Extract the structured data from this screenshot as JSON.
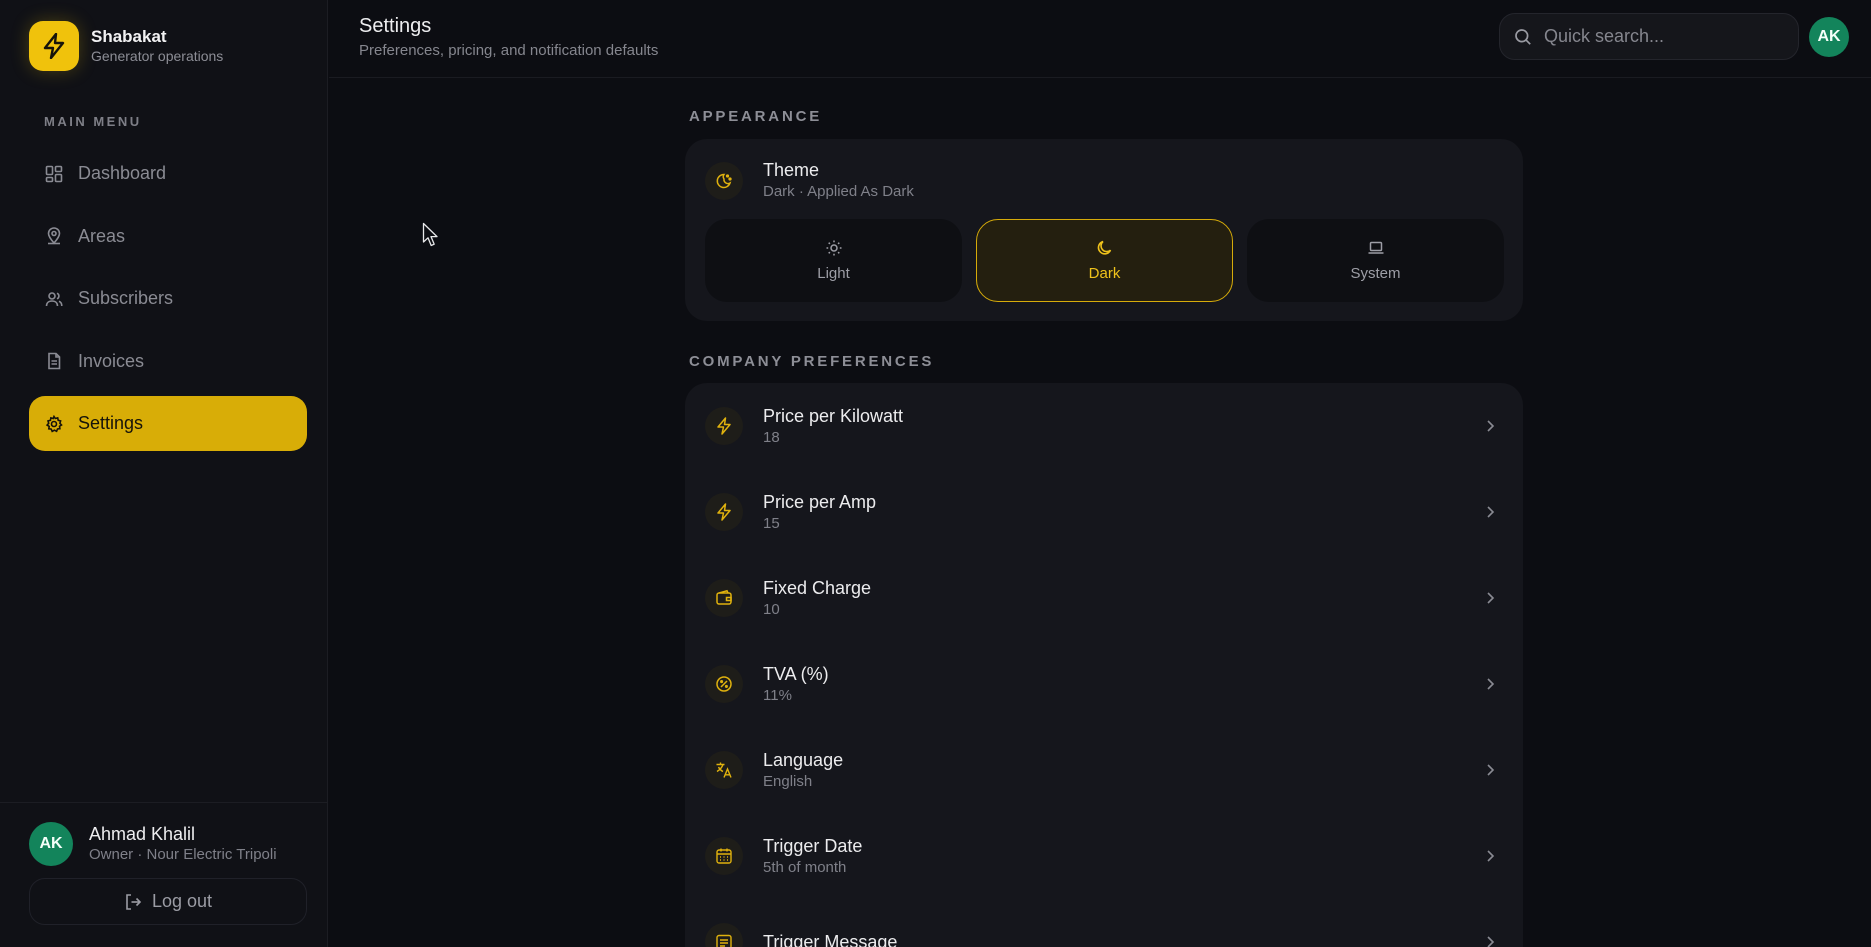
{
  "brand": {
    "name": "Shabakat",
    "subtitle": "Generator operations",
    "logo_icon": "bolt-icon",
    "accent": "#f0c20c"
  },
  "sidebar": {
    "menu_title": "MAIN MENU",
    "items": [
      {
        "label": "Dashboard",
        "icon": "grid-icon",
        "active": false
      },
      {
        "label": "Areas",
        "icon": "map-pin-icon",
        "active": false
      },
      {
        "label": "Subscribers",
        "icon": "users-icon",
        "active": false
      },
      {
        "label": "Invoices",
        "icon": "document-icon",
        "active": false
      },
      {
        "label": "Settings",
        "icon": "gear-icon",
        "active": true
      }
    ],
    "user": {
      "initials": "AK",
      "name": "Ahmad Khalil",
      "role": "Owner · Nour Electric Tripoli"
    },
    "logout_label": "Log out"
  },
  "header": {
    "title": "Settings",
    "subtitle": "Preferences, pricing, and notification defaults",
    "search_placeholder": "Quick search...",
    "avatar_initials": "AK"
  },
  "appearance": {
    "section_title": "APPEARANCE",
    "theme": {
      "title": "Theme",
      "subtitle": "Dark · Applied As Dark",
      "options": [
        {
          "label": "Light",
          "icon": "sun-icon",
          "selected": false
        },
        {
          "label": "Dark",
          "icon": "moon-icon",
          "selected": true
        },
        {
          "label": "System",
          "icon": "laptop-icon",
          "selected": false
        }
      ]
    }
  },
  "company_preferences": {
    "section_title": "COMPANY PREFERENCES",
    "rows": [
      {
        "title": "Price per Kilowatt",
        "value": "18",
        "icon": "bolt-icon"
      },
      {
        "title": "Price per Amp",
        "value": "15",
        "icon": "bolt-icon"
      },
      {
        "title": "Fixed Charge",
        "value": "10",
        "icon": "wallet-icon"
      },
      {
        "title": "TVA (%)",
        "value": "11%",
        "icon": "percent-icon"
      },
      {
        "title": "Language",
        "value": "English",
        "icon": "translate-icon"
      },
      {
        "title": "Trigger Date",
        "value": "5th of month",
        "icon": "calendar-icon"
      },
      {
        "title": "Trigger Message",
        "value": "",
        "icon": "message-icon"
      }
    ]
  },
  "colors": {
    "accent": "#d8ad07",
    "background": "#0c0d12",
    "avatar": "#13845b"
  }
}
